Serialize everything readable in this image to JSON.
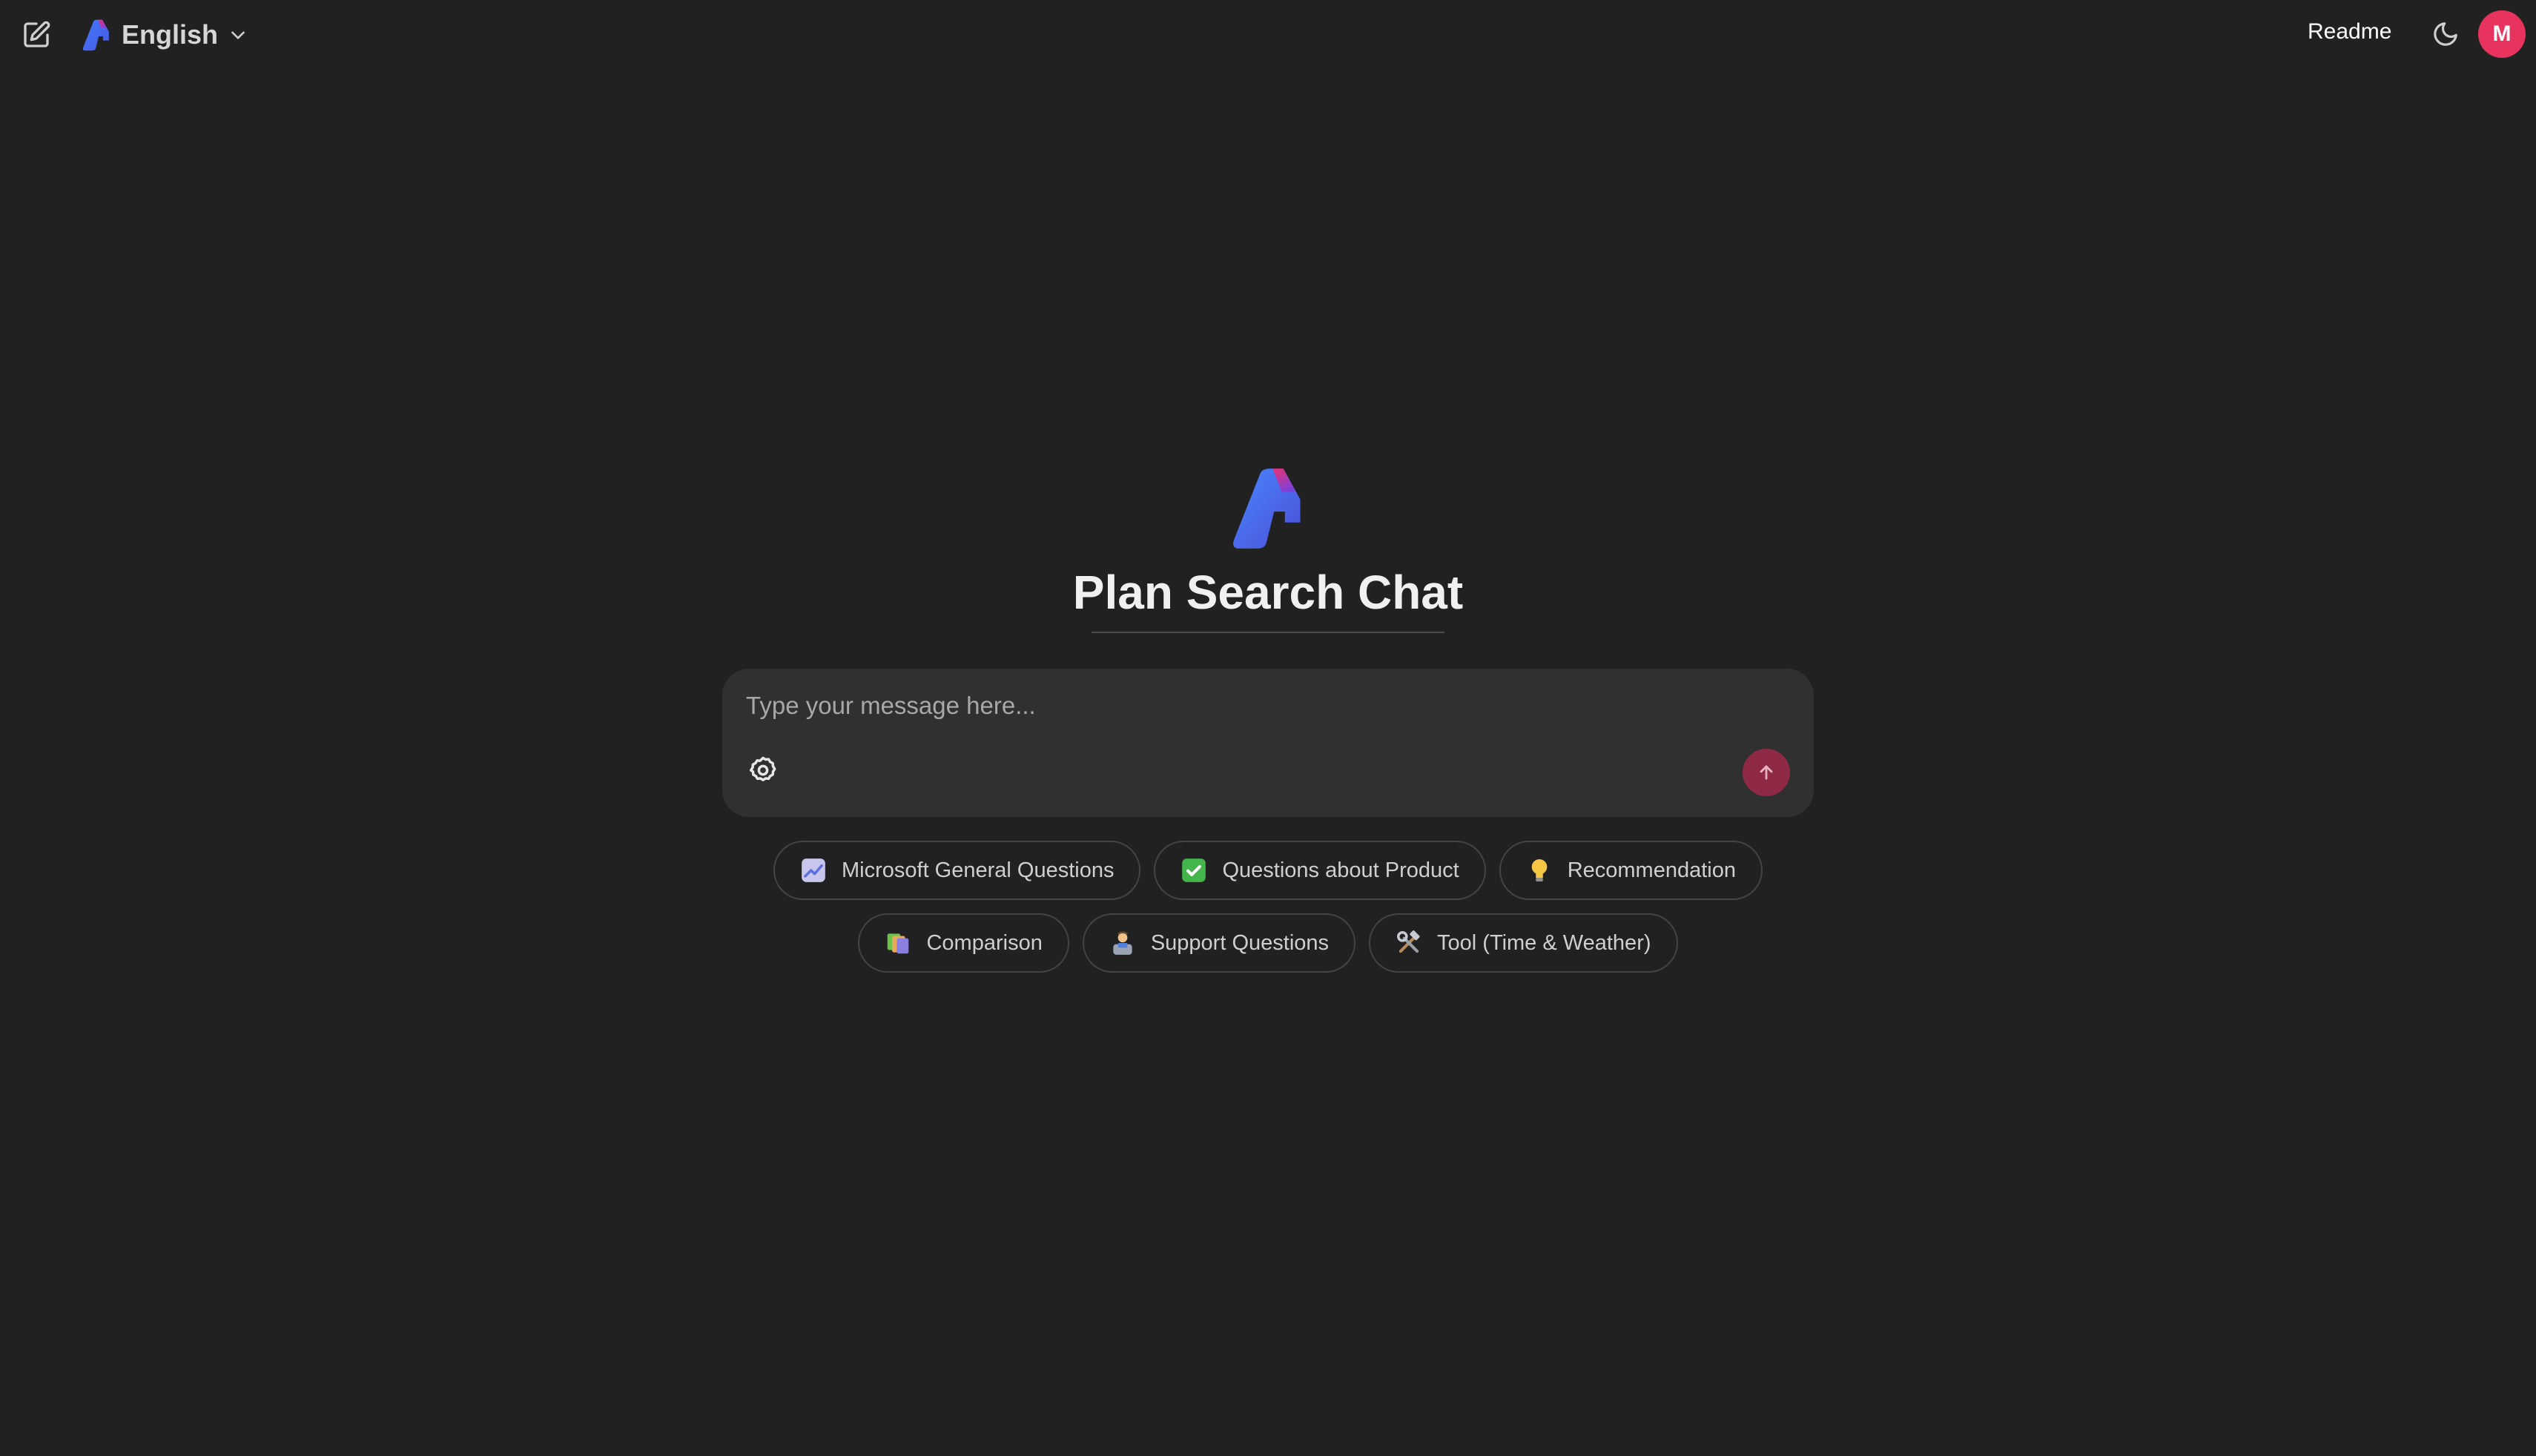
{
  "header": {
    "language_label": "English",
    "readme_label": "Readme",
    "avatar_initial": "M",
    "avatar_color": "#e8335f"
  },
  "main": {
    "title": "Plan Search Chat"
  },
  "composer": {
    "placeholder": "Type your message here...",
    "send_color": "#8f2a44"
  },
  "suggestions": {
    "row1": [
      {
        "label": "Microsoft General Questions",
        "icon": "chart-increasing-icon"
      },
      {
        "label": "Questions about Product",
        "icon": "check-mark-button-icon"
      },
      {
        "label": "Recommendation",
        "icon": "light-bulb-icon"
      }
    ],
    "row2": [
      {
        "label": "Comparison",
        "icon": "bookmark-tabs-icon"
      },
      {
        "label": "Support Questions",
        "icon": "support-agent-icon"
      },
      {
        "label": "Tool (Time & Weather)",
        "icon": "hammer-and-wrench-icon"
      }
    ]
  }
}
